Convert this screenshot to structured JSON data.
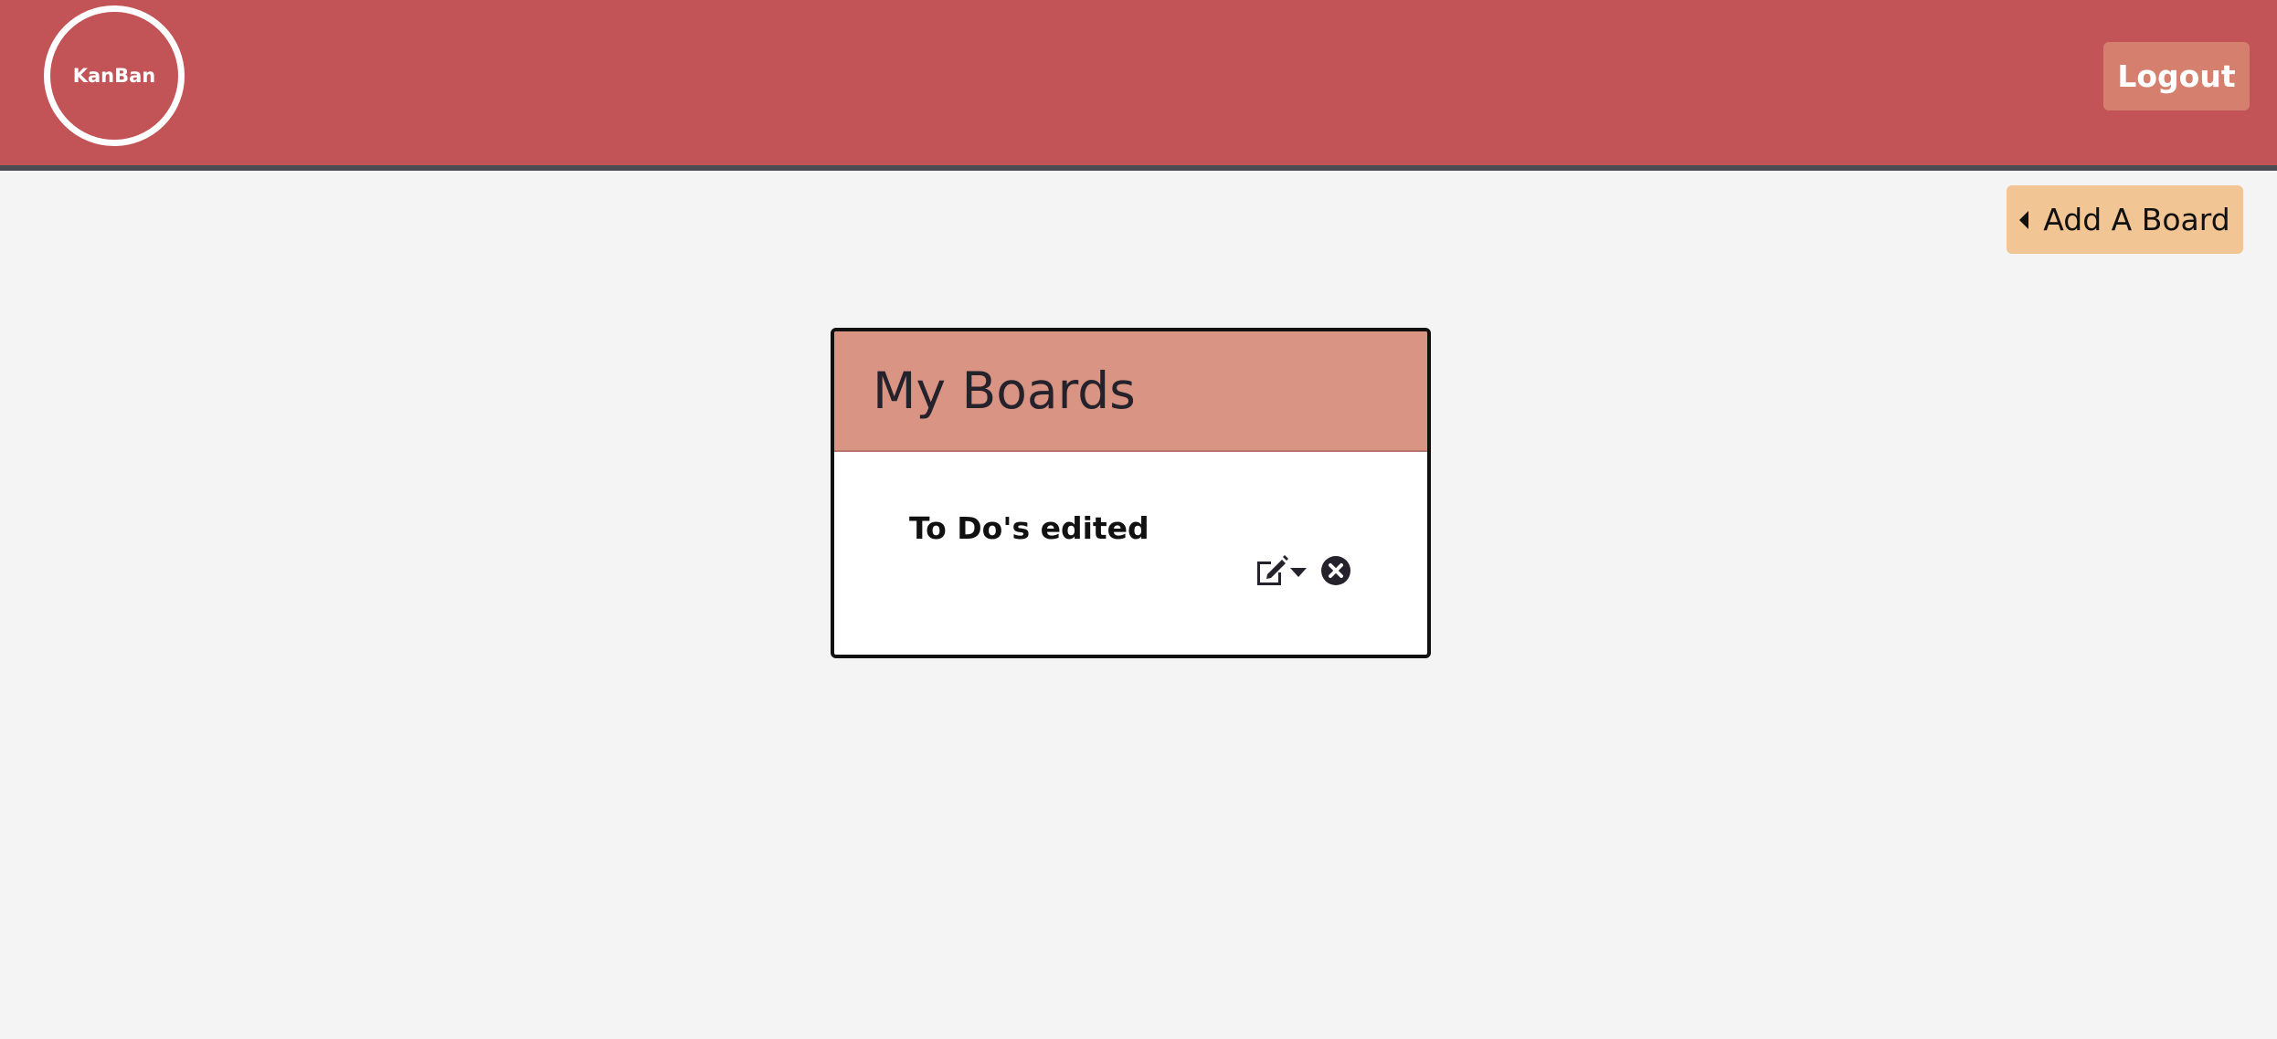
{
  "header": {
    "logo_text": "KanBan",
    "logout_label": "Logout"
  },
  "toolbar": {
    "add_board_label": "Add A Board"
  },
  "boards_card": {
    "title": "My Boards",
    "items": [
      {
        "label": "To Do's edited"
      }
    ]
  },
  "icons": {
    "add_board_icon": "caret-left-icon",
    "edit_icon": "pencil-square-icon",
    "dropdown_icon": "caret-down-icon",
    "delete_icon": "circle-x-icon"
  },
  "colors": {
    "header_bg": "#c25356",
    "logout_bg": "#d5806f",
    "add_board_bg": "#f2c595",
    "card_header_bg": "#d99484",
    "page_bg": "#f4f4f4"
  }
}
